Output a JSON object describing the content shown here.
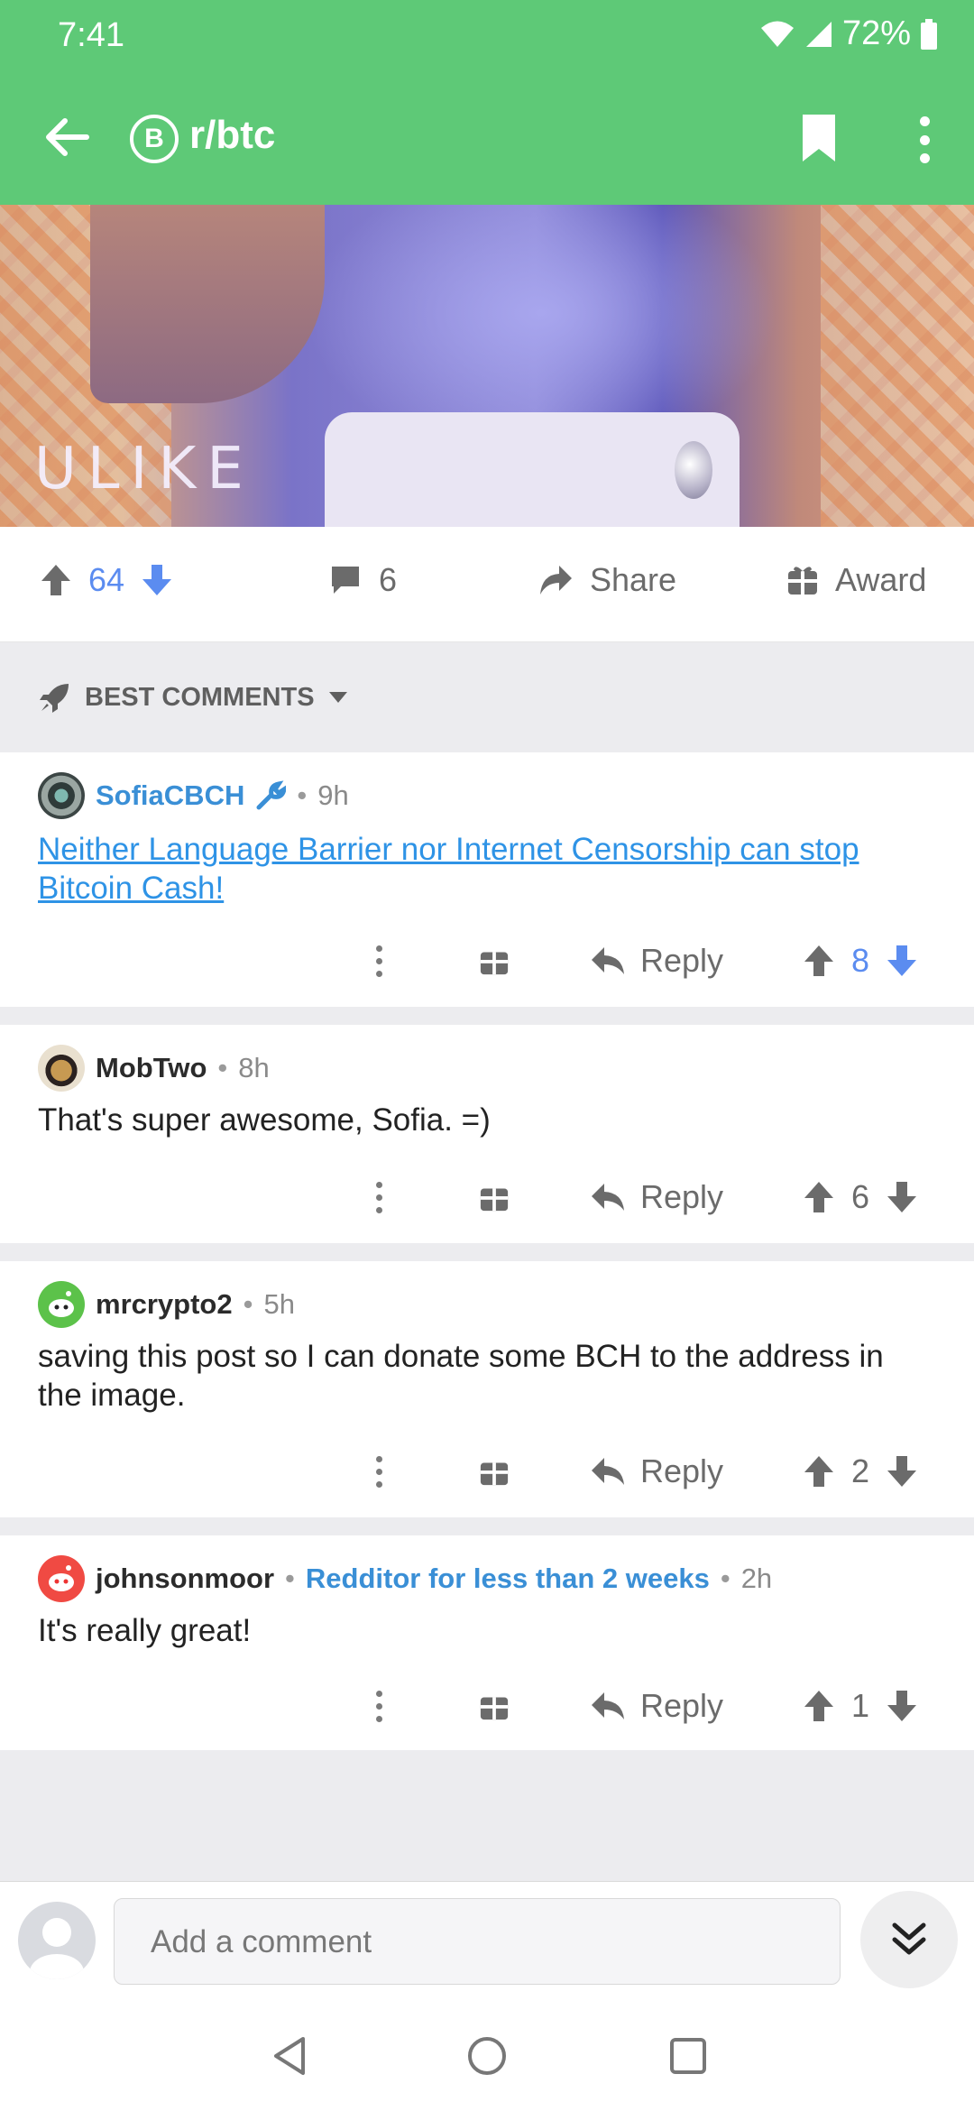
{
  "status_bar": {
    "time": "7:41",
    "battery": "72%"
  },
  "app_bar": {
    "title": "r/btc",
    "sub_logo": "B"
  },
  "hero_image": {
    "watermark": "ULIKE"
  },
  "post_actions": {
    "score": "64",
    "comments": "6",
    "share_label": "Share",
    "award_label": "Award"
  },
  "sort": {
    "label": "BEST COMMENTS"
  },
  "comments": [
    {
      "author": "SofiaCBCH",
      "time": "9h",
      "body": "Neither Language Barrier nor Internet Censorship can stop Bitcoin Cash!",
      "reply_label": "Reply",
      "score": "8",
      "flair": ""
    },
    {
      "author": "MobTwo",
      "time": "8h",
      "body": "That's super awesome, Sofia. =)",
      "reply_label": "Reply",
      "score": "6",
      "flair": ""
    },
    {
      "author": "mrcrypto2",
      "time": "5h",
      "body": "saving this post so I can donate some BCH to the address in the image.",
      "reply_label": "Reply",
      "score": "2",
      "flair": ""
    },
    {
      "author": "johnsonmoor",
      "time": "2h",
      "body": "It's really great!",
      "reply_label": "Reply",
      "score": "1",
      "flair": "Redditor for less than 2 weeks"
    }
  ],
  "composer": {
    "placeholder": "Add a comment"
  },
  "colors": {
    "app_bar": "#5ec977",
    "upvote_blue": "#5b8cf0",
    "link_blue": "#2e93e6"
  }
}
